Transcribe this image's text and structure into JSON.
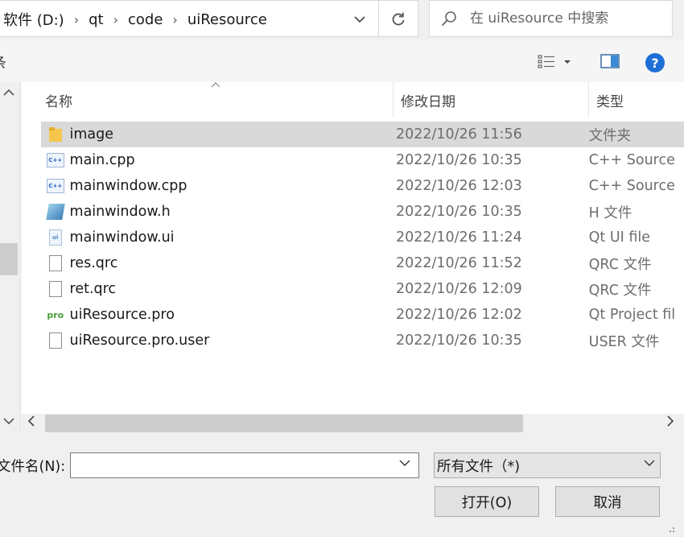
{
  "address": {
    "crumbs": [
      "软件 (D:)",
      "qt",
      "code",
      "uiResource"
    ],
    "separator": "›"
  },
  "search": {
    "placeholder": "在 uiResource 中搜索"
  },
  "toolbar": {
    "left_text": "条"
  },
  "columns": {
    "name": "名称",
    "date": "修改日期",
    "type": "类型"
  },
  "files": [
    {
      "icon": "folder-icon",
      "name": "image",
      "date": "2022/10/26 11:56",
      "type": "文件夹",
      "selected": true
    },
    {
      "icon": "cpp-file-icon",
      "name": "main.cpp",
      "date": "2022/10/26 10:35",
      "type": "C++ Source"
    },
    {
      "icon": "cpp-file-icon",
      "name": "mainwindow.cpp",
      "date": "2022/10/26 12:03",
      "type": "C++ Source"
    },
    {
      "icon": "header-file-icon",
      "name": "mainwindow.h",
      "date": "2022/10/26 10:35",
      "type": "H 文件"
    },
    {
      "icon": "ui-file-icon",
      "name": "mainwindow.ui",
      "date": "2022/10/26 11:24",
      "type": "Qt UI file"
    },
    {
      "icon": "blank-file-icon",
      "name": "res.qrc",
      "date": "2022/10/26 11:52",
      "type": "QRC 文件"
    },
    {
      "icon": "blank-file-icon",
      "name": "ret.qrc",
      "date": "2022/10/26 12:09",
      "type": "QRC 文件"
    },
    {
      "icon": "pro-file-icon",
      "name": "uiResource.pro",
      "date": "2022/10/26 12:02",
      "type": "Qt Project fil"
    },
    {
      "icon": "blank-file-icon",
      "name": "uiResource.pro.user",
      "date": "2022/10/26 10:35",
      "type": "USER 文件"
    }
  ],
  "filename": {
    "label": "文件名(N):",
    "value": ""
  },
  "filter": {
    "value": "所有文件（*)"
  },
  "buttons": {
    "open": "打开(O)",
    "cancel": "取消"
  },
  "colors": {
    "selected_row": "#d9d9d9",
    "help_blue": "#1e6fd6",
    "secondary_text": "#6d6d6d"
  }
}
